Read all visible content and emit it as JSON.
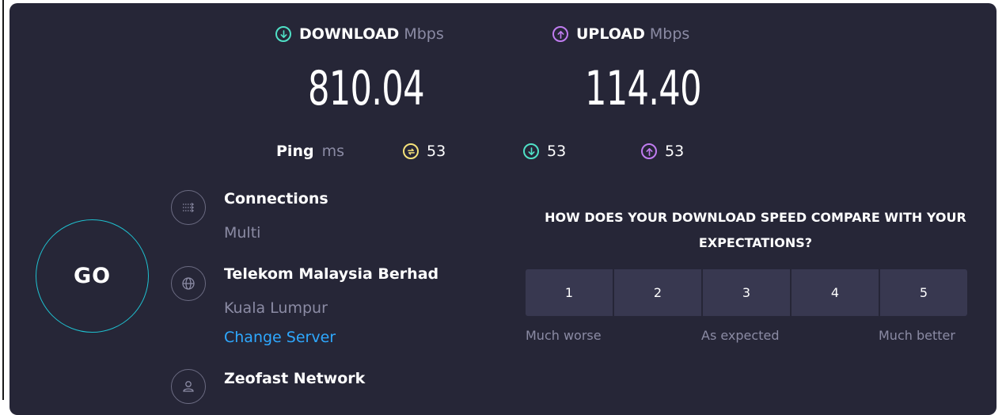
{
  "download": {
    "label": "DOWNLOAD",
    "unit": "Mbps",
    "value": "810.04",
    "color": "#4fe0c6",
    "icon": "download-arrow-icon"
  },
  "upload": {
    "label": "UPLOAD",
    "unit": "Mbps",
    "value": "114.40",
    "color": "#c07cf0",
    "icon": "upload-arrow-icon"
  },
  "ping": {
    "label": "Ping",
    "unit": "ms",
    "idle": {
      "value": "53",
      "color": "#f5e27a",
      "icon": "ping-idle-icon"
    },
    "down": {
      "value": "53",
      "color": "#4fe0c6",
      "icon": "ping-download-icon"
    },
    "up": {
      "value": "53",
      "color": "#c07cf0",
      "icon": "ping-upload-icon"
    }
  },
  "go_button": {
    "label": "GO",
    "ring_color": "#1fc1d0"
  },
  "connections": {
    "title": "Connections",
    "value": "Multi",
    "icon": "connections-icon"
  },
  "server": {
    "title": "Telekom Malaysia Berhad",
    "location": "Kuala Lumpur",
    "change_link": "Change Server",
    "icon": "globe-icon"
  },
  "provider": {
    "title": "Zeofast Network",
    "icon": "user-icon"
  },
  "survey": {
    "question": "HOW DOES YOUR DOWNLOAD SPEED COMPARE WITH YOUR EXPECTATIONS?",
    "options": [
      "1",
      "2",
      "3",
      "4",
      "5"
    ],
    "labels": {
      "low": "Much worse",
      "mid": "As expected",
      "high": "Much better"
    }
  }
}
